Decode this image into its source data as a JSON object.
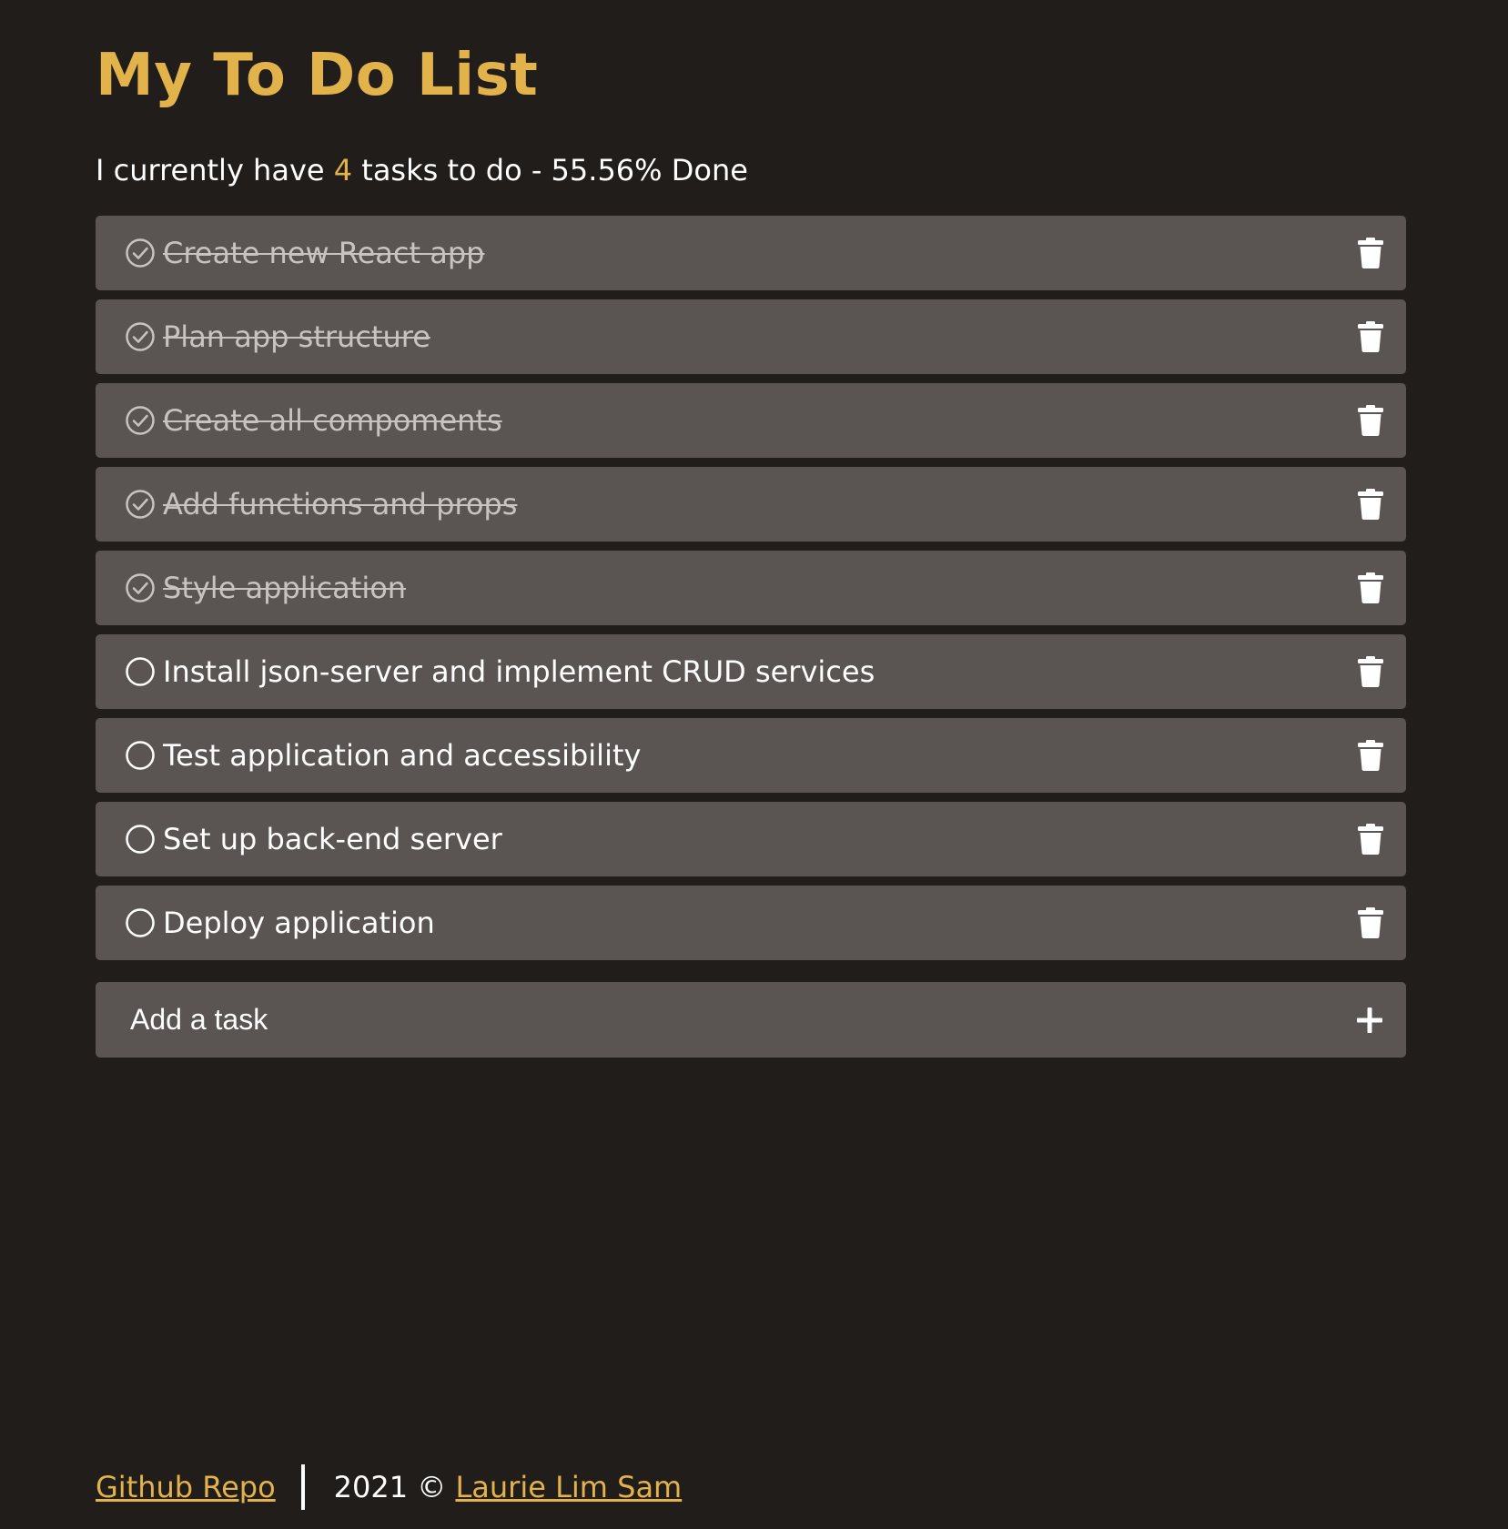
{
  "header": {
    "title": "My To Do List"
  },
  "summary": {
    "prefix": "I currently have ",
    "count": "4",
    "suffix": " tasks to do - 55.56% Done"
  },
  "tasks": [
    {
      "label": "Create new React app",
      "done": true
    },
    {
      "label": "Plan app structure",
      "done": true
    },
    {
      "label": "Create all compoments",
      "done": true
    },
    {
      "label": "Add functions and props",
      "done": true
    },
    {
      "label": "Style application",
      "done": true
    },
    {
      "label": "Install json-server and implement CRUD services",
      "done": false
    },
    {
      "label": "Test application and accessibility",
      "done": false
    },
    {
      "label": "Set up back-end server",
      "done": false
    },
    {
      "label": "Deploy application",
      "done": false
    }
  ],
  "add_task": {
    "placeholder": "Add a task",
    "icon": "plus-icon"
  },
  "footer": {
    "repo_link": "Github Repo",
    "copyright": "2021 © ",
    "author_link": "Laurie Lim Sam"
  },
  "colors": {
    "background": "#201d1b",
    "accent": "#e2b24b",
    "card": "#5a5552",
    "text": "#ffffff",
    "done_text": "#c8c3bf"
  }
}
